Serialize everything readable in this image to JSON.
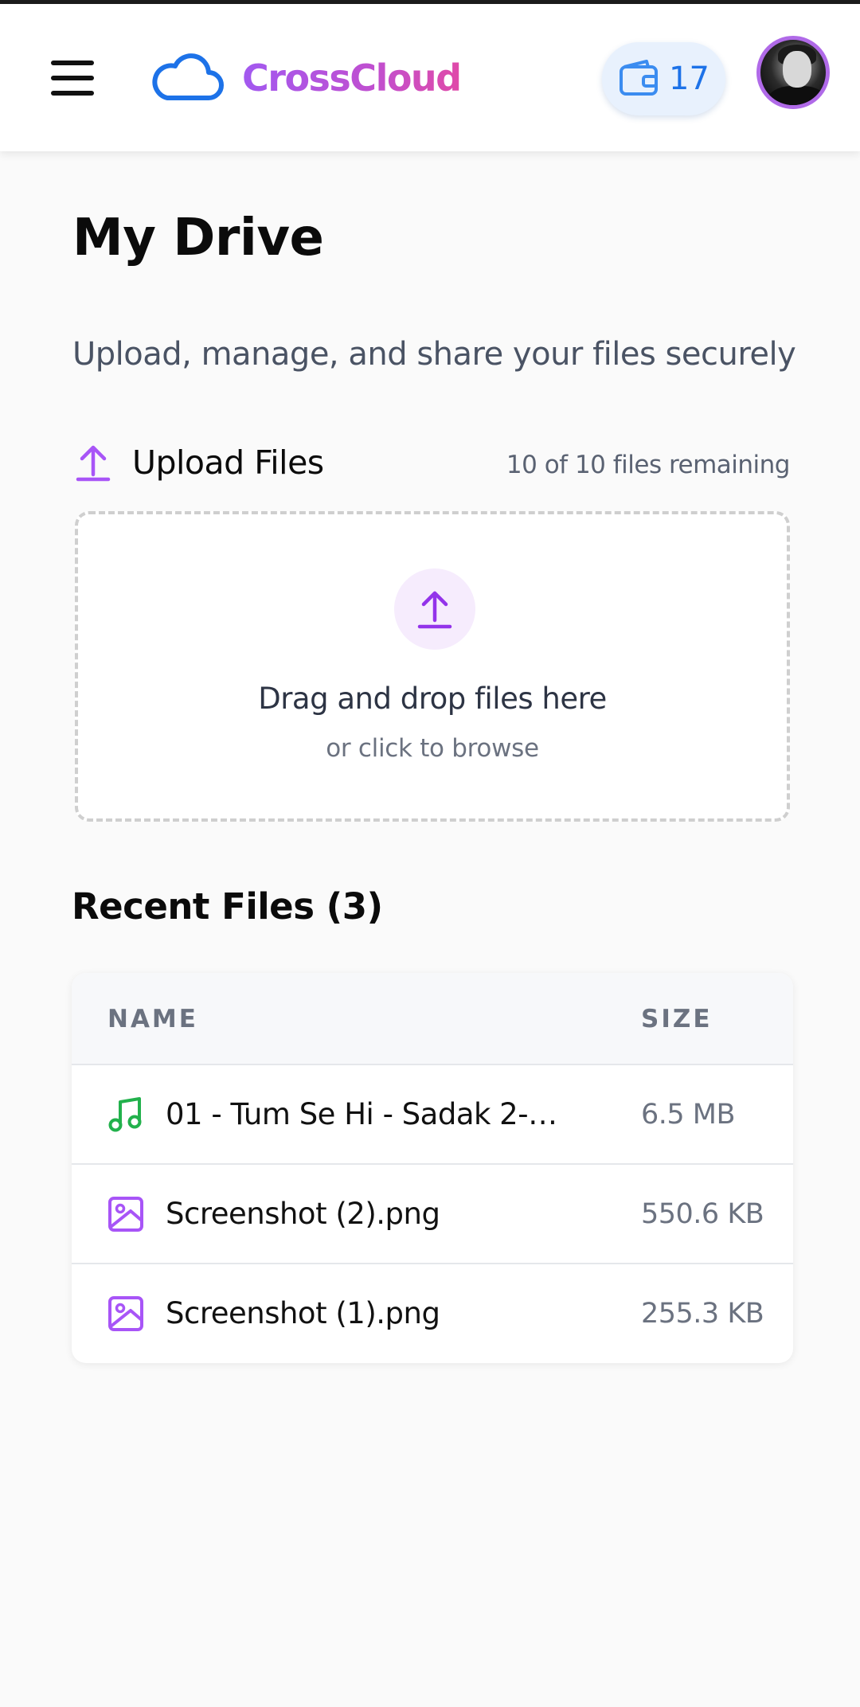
{
  "app": {
    "name": "CrossCloud",
    "credits": "17"
  },
  "page": {
    "title": "My Drive",
    "subtitle": "Upload, manage, and share your files securely"
  },
  "upload": {
    "title": "Upload Files",
    "remaining": "10 of 10 files remaining",
    "drop_text": "Drag and drop files here",
    "drop_subtext": "or click to browse"
  },
  "recent": {
    "title": "Recent Files (3)",
    "columns": [
      "NAME",
      "SIZE"
    ],
    "files": [
      {
        "name": "01 - Tum Se Hi - Sadak 2-2...",
        "size": "6.5 MB",
        "icon": "music-note-icon",
        "color": "#22b14c"
      },
      {
        "name": "Screenshot (2).png",
        "size": "550.6 KB",
        "icon": "image-icon",
        "color": "#a855f7"
      },
      {
        "name": "Screenshot (1).png",
        "size": "255.3 KB",
        "icon": "image-icon",
        "color": "#a855f7"
      }
    ]
  },
  "colors": {
    "accent_purple": "#a259f0",
    "accent_blue": "#1d72e8",
    "music_green": "#22b14c"
  }
}
